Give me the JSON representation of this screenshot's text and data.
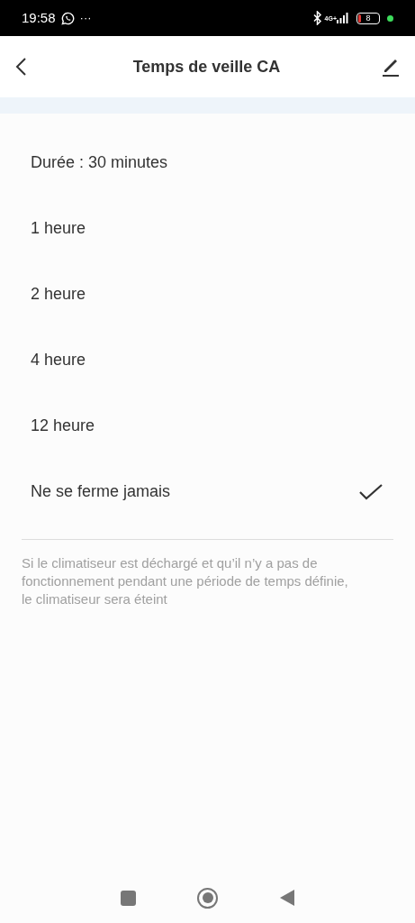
{
  "status_bar": {
    "time": "19:58",
    "overflow": "···",
    "network": "4G+",
    "battery": "8"
  },
  "header": {
    "title": "Temps de veille CA"
  },
  "options": [
    {
      "label": "Durée : 30 minutes",
      "selected": false
    },
    {
      "label": "1 heure",
      "selected": false
    },
    {
      "label": "2 heure",
      "selected": false
    },
    {
      "label": "4 heure",
      "selected": false
    },
    {
      "label": "12 heure",
      "selected": false
    },
    {
      "label": "Ne se ferme jamais",
      "selected": true
    }
  ],
  "note": "Si le climatiseur est déchargé et qu’il n’y a pas de fonctionnement pendant une période de temps définie, le climatiseur sera éteint"
}
